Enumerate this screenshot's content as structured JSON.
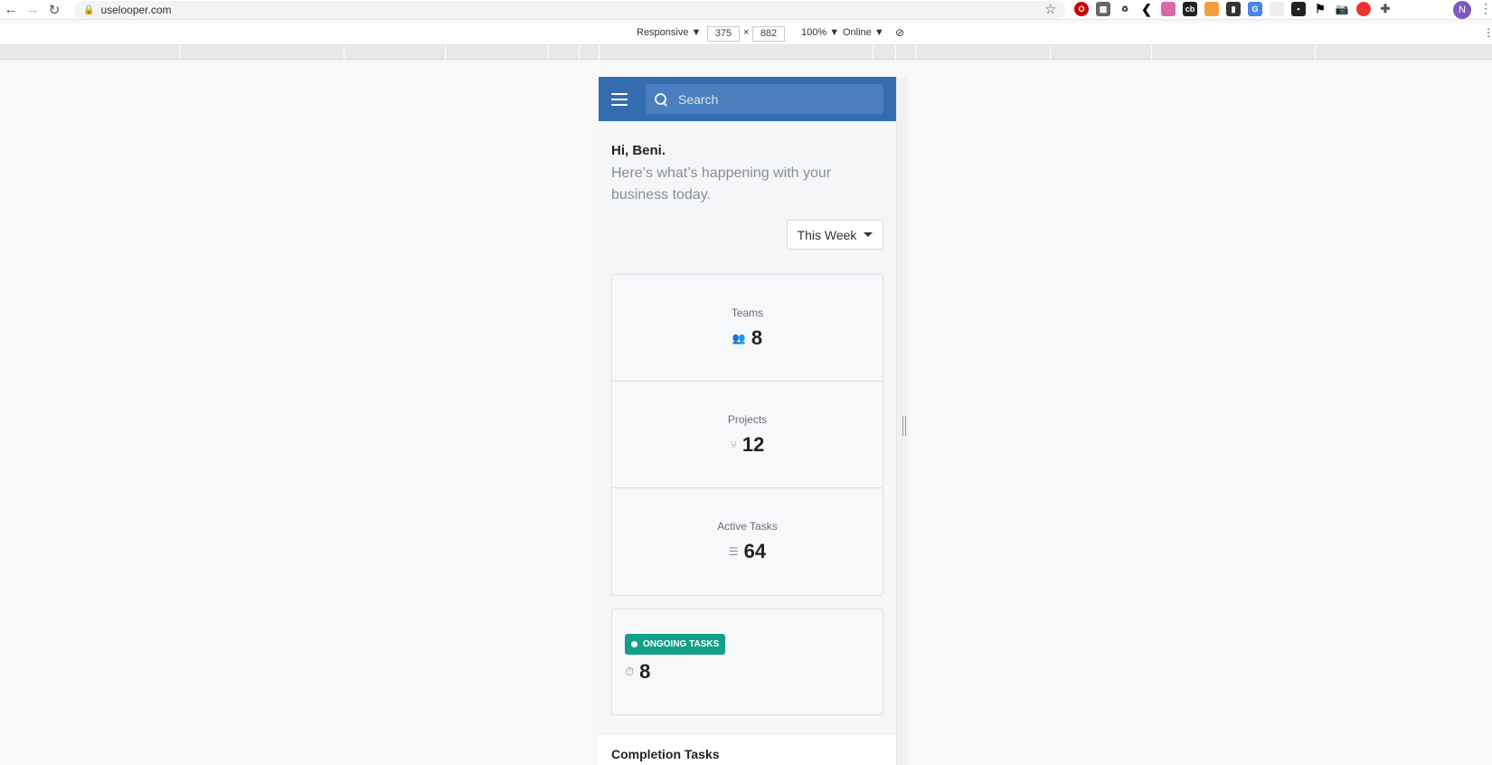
{
  "browser": {
    "url": "uselooper.com",
    "profile_initial": "N"
  },
  "devtools": {
    "device": "Responsive ▼",
    "width": "375",
    "times": "×",
    "height": "882",
    "zoom": "100% ▼",
    "network": "Online ▼"
  },
  "app": {
    "search_placeholder": "Search",
    "greeting": "Hi, Beni.",
    "subtitle": "Here’s what’s happening with your business today.",
    "filter_label": "This Week",
    "stats": [
      {
        "label": "Teams",
        "value": "8",
        "icon": "users-icon"
      },
      {
        "label": "Projects",
        "value": "12",
        "icon": "git-branch-icon"
      },
      {
        "label": "Active Tasks",
        "value": "64",
        "icon": "tasks-list-icon"
      }
    ],
    "ongoing": {
      "badge": "ONGOING TASKS",
      "value": "8",
      "icon": "stopwatch-icon"
    },
    "completion_title": "Completion Tasks"
  },
  "colors": {
    "header": "#346cb0",
    "badge": "#12a08a"
  }
}
